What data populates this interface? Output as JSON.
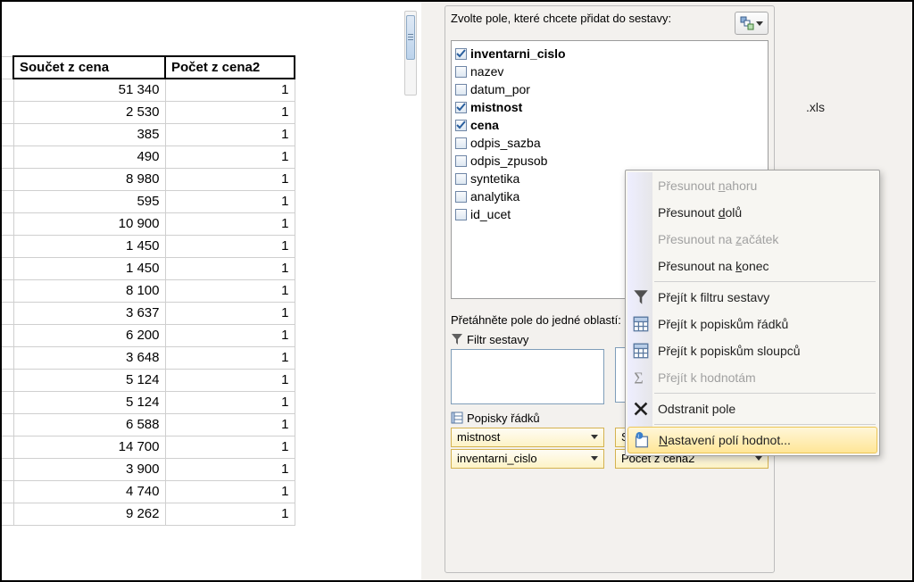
{
  "table": {
    "headers": {
      "c1": "Součet z cena",
      "c2": "Počet z cena2"
    },
    "rows": [
      {
        "v1": "51 340",
        "v2": "1"
      },
      {
        "v1": "2 530",
        "v2": "1"
      },
      {
        "v1": "385",
        "v2": "1"
      },
      {
        "v1": "490",
        "v2": "1"
      },
      {
        "v1": "8 980",
        "v2": "1"
      },
      {
        "v1": "595",
        "v2": "1"
      },
      {
        "v1": "10 900",
        "v2": "1"
      },
      {
        "v1": "1 450",
        "v2": "1"
      },
      {
        "v1": "1 450",
        "v2": "1"
      },
      {
        "v1": "8 100",
        "v2": "1"
      },
      {
        "v1": "3 637",
        "v2": "1"
      },
      {
        "v1": "6 200",
        "v2": "1"
      },
      {
        "v1": "3 648",
        "v2": "1"
      },
      {
        "v1": "5 124",
        "v2": "1"
      },
      {
        "v1": "5 124",
        "v2": "1"
      },
      {
        "v1": "6 588",
        "v2": "1"
      },
      {
        "v1": "14 700",
        "v2": "1"
      },
      {
        "v1": "3 900",
        "v2": "1"
      },
      {
        "v1": "4 740",
        "v2": "1"
      },
      {
        "v1": "9 262",
        "v2": "1"
      }
    ]
  },
  "panel": {
    "choose_label": "Zvolte pole, které chcete přidat do sestavy:",
    "fields": [
      {
        "name": "inventarni_cislo",
        "checked": true
      },
      {
        "name": "nazev",
        "checked": false
      },
      {
        "name": "datum_por",
        "checked": false
      },
      {
        "name": "mistnost",
        "checked": true
      },
      {
        "name": "cena",
        "checked": true
      },
      {
        "name": "odpis_sazba",
        "checked": false
      },
      {
        "name": "odpis_zpusob",
        "checked": false
      },
      {
        "name": "syntetika",
        "checked": false
      },
      {
        "name": "analytika",
        "checked": false
      },
      {
        "name": "id_ucet",
        "checked": false
      }
    ],
    "drag_label": "Přetáhněte pole do jedné oblastí:",
    "zone_filter": "Filtr sestavy",
    "zone_rows": "Popisky řádků",
    "row_tags": [
      "mistnost",
      "inventarni_cislo"
    ],
    "val_tags": [
      "Součet z cena",
      "Počet z cena2"
    ]
  },
  "ctx": {
    "items": [
      {
        "type": "mi",
        "disabled": true,
        "text": "Přesunout ",
        "u": "n",
        "rest": "ahoru",
        "icon": ""
      },
      {
        "type": "mi",
        "disabled": false,
        "text": "Přesunout ",
        "u": "d",
        "rest": "olů",
        "icon": ""
      },
      {
        "type": "mi",
        "disabled": true,
        "text": "Přesunout na ",
        "u": "z",
        "rest": "ačátek",
        "icon": ""
      },
      {
        "type": "mi",
        "disabled": false,
        "text": "Přesunout na ",
        "u": "k",
        "rest": "onec",
        "icon": ""
      },
      {
        "type": "sep"
      },
      {
        "type": "mi",
        "disabled": false,
        "text": "Přejít k filtru sestavy",
        "u": "",
        "rest": "",
        "icon": "funnel"
      },
      {
        "type": "mi",
        "disabled": false,
        "text": "Přejít k popiskům řádků",
        "u": "",
        "rest": "",
        "icon": "grid"
      },
      {
        "type": "mi",
        "disabled": false,
        "text": "Přejít k popiskům sloupců",
        "u": "",
        "rest": "",
        "icon": "grid"
      },
      {
        "type": "mi",
        "disabled": true,
        "text": "Přejít k hodnotám",
        "u": "",
        "rest": "",
        "icon": "sigma"
      },
      {
        "type": "sep"
      },
      {
        "type": "mi",
        "disabled": false,
        "text": "Odstranit pole",
        "u": "",
        "rest": "",
        "icon": "x"
      },
      {
        "type": "sep"
      },
      {
        "type": "mi",
        "disabled": false,
        "text": "",
        "u": "N",
        "rest": "astavení polí hodnot...",
        "icon": "info",
        "hover": true
      }
    ]
  },
  "file_peek": ".xls"
}
